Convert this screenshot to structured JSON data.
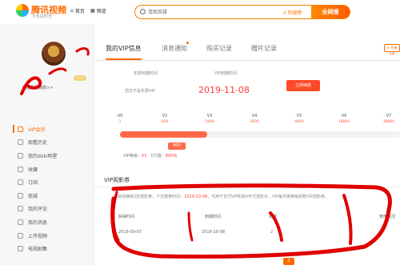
{
  "header": {
    "logo_text": "腾讯视频",
    "logo_sub": "不负好时光",
    "nav": [
      {
        "label": "首页",
        "icon": "home-icon"
      },
      {
        "label": "频道",
        "icon": "grid-icon"
      }
    ],
    "search_placeholder": "鼠图英雄",
    "hot_label": "热搜榜",
    "all_net_label": "全网搜"
  },
  "profile": {
    "username": "",
    "vip_badge": "",
    "manage_link": "管理我的偶像>>"
  },
  "sidebar": {
    "items": [
      {
        "label": "VIP会员",
        "active": true
      },
      {
        "label": "观看历史"
      },
      {
        "label": "我的doki明星"
      },
      {
        "label": "收藏"
      },
      {
        "label": "订阅"
      },
      {
        "label": "商城"
      },
      {
        "label": "我的评论"
      },
      {
        "label": "我的消息"
      },
      {
        "label": "上传视频"
      },
      {
        "label": "电视剧集"
      }
    ]
  },
  "tabs": [
    {
      "label": "我的VIP信息",
      "active": true
    },
    {
      "label": "消息通知"
    },
    {
      "label": "购买记录"
    },
    {
      "label": "赠片记录"
    }
  ],
  "renew_tag": "< 完善VIP",
  "vip_info": {
    "annual_label": "年费到期时间",
    "annual_value": "您还不是年费VIP",
    "vip_label": "VIP到期时间",
    "vip_value": "2019-11-08",
    "renew_button": "立即续费"
  },
  "levels": [
    {
      "name": "V0",
      "points": "1"
    },
    {
      "name": "V2",
      "points": "600"
    },
    {
      "name": "V3",
      "points": "1800"
    },
    {
      "name": "V4",
      "points": "3600"
    },
    {
      "name": "V5",
      "points": "8000"
    },
    {
      "name": "V6",
      "points": "16800"
    },
    {
      "name": "V7",
      "points": "38800"
    }
  ],
  "progress": {
    "current_value_label": "800",
    "fraction": 0.31
  },
  "vip_stat": {
    "level_label": "VIP等级：",
    "level_value": "V2",
    "growth_label": "V力值：",
    "growth_value": "800点"
  },
  "coupon": {
    "section_title": "VIP观影券",
    "notice_pre": "您目前拥有2张观影券，下次赠券时间：",
    "notice_date": "2019-10-08",
    "notice_post": "，可用于支付VIP影院VIP付费影片。VIP每月按等级获赠VIP观影券。",
    "columns": [
      "获得时间",
      "到期时间",
      "张数",
      "使用情况"
    ],
    "rows": [
      {
        "obtained": "2019-09-07",
        "expire": "2019-10-08",
        "count": "2",
        "usage": ""
      }
    ]
  },
  "pagination": {
    "current": "1"
  },
  "colors": {
    "accent": "#ff6a00",
    "highlight": "#ff3b3b"
  }
}
